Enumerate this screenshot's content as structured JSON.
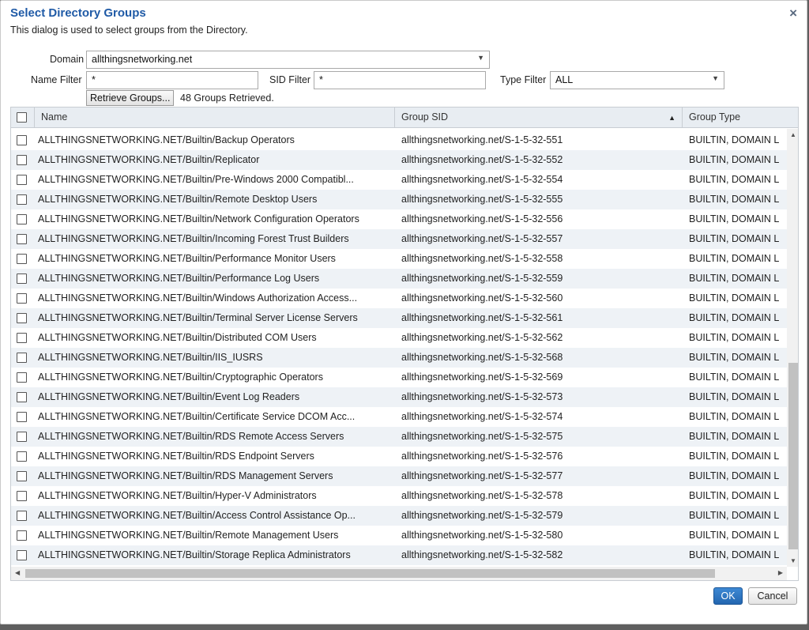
{
  "dialog": {
    "title": "Select Directory Groups",
    "subtitle": "This dialog is used to select groups from the Directory.",
    "close_icon": "×"
  },
  "filters": {
    "domain_label": "Domain",
    "domain_value": "allthingsnetworking.net",
    "name_filter_label": "Name Filter",
    "name_filter_value": "*",
    "sid_filter_label": "SID Filter",
    "sid_filter_value": "*",
    "type_filter_label": "Type Filter",
    "type_filter_value": "ALL",
    "retrieve_button": "Retrieve Groups...",
    "retrieved_status": "48 Groups Retrieved."
  },
  "table": {
    "columns": [
      "Name",
      "Group SID",
      "Group Type"
    ],
    "sort_indicator": "▲",
    "rows": [
      {
        "name": "ALLTHINGSNETWORKING.NET/Builtin/Backup Operators",
        "sid": "allthingsnetworking.net/S-1-5-32-551",
        "type": "BUILTIN, DOMAIN L"
      },
      {
        "name": "ALLTHINGSNETWORKING.NET/Builtin/Replicator",
        "sid": "allthingsnetworking.net/S-1-5-32-552",
        "type": "BUILTIN, DOMAIN L"
      },
      {
        "name": "ALLTHINGSNETWORKING.NET/Builtin/Pre-Windows 2000 Compatibl...",
        "sid": "allthingsnetworking.net/S-1-5-32-554",
        "type": "BUILTIN, DOMAIN L"
      },
      {
        "name": "ALLTHINGSNETWORKING.NET/Builtin/Remote Desktop Users",
        "sid": "allthingsnetworking.net/S-1-5-32-555",
        "type": "BUILTIN, DOMAIN L"
      },
      {
        "name": "ALLTHINGSNETWORKING.NET/Builtin/Network Configuration Operators",
        "sid": "allthingsnetworking.net/S-1-5-32-556",
        "type": "BUILTIN, DOMAIN L"
      },
      {
        "name": "ALLTHINGSNETWORKING.NET/Builtin/Incoming Forest Trust Builders",
        "sid": "allthingsnetworking.net/S-1-5-32-557",
        "type": "BUILTIN, DOMAIN L"
      },
      {
        "name": "ALLTHINGSNETWORKING.NET/Builtin/Performance Monitor Users",
        "sid": "allthingsnetworking.net/S-1-5-32-558",
        "type": "BUILTIN, DOMAIN L"
      },
      {
        "name": "ALLTHINGSNETWORKING.NET/Builtin/Performance Log Users",
        "sid": "allthingsnetworking.net/S-1-5-32-559",
        "type": "BUILTIN, DOMAIN L"
      },
      {
        "name": "ALLTHINGSNETWORKING.NET/Builtin/Windows Authorization Access...",
        "sid": "allthingsnetworking.net/S-1-5-32-560",
        "type": "BUILTIN, DOMAIN L"
      },
      {
        "name": "ALLTHINGSNETWORKING.NET/Builtin/Terminal Server License Servers",
        "sid": "allthingsnetworking.net/S-1-5-32-561",
        "type": "BUILTIN, DOMAIN L"
      },
      {
        "name": "ALLTHINGSNETWORKING.NET/Builtin/Distributed COM Users",
        "sid": "allthingsnetworking.net/S-1-5-32-562",
        "type": "BUILTIN, DOMAIN L"
      },
      {
        "name": "ALLTHINGSNETWORKING.NET/Builtin/IIS_IUSRS",
        "sid": "allthingsnetworking.net/S-1-5-32-568",
        "type": "BUILTIN, DOMAIN L"
      },
      {
        "name": "ALLTHINGSNETWORKING.NET/Builtin/Cryptographic Operators",
        "sid": "allthingsnetworking.net/S-1-5-32-569",
        "type": "BUILTIN, DOMAIN L"
      },
      {
        "name": "ALLTHINGSNETWORKING.NET/Builtin/Event Log Readers",
        "sid": "allthingsnetworking.net/S-1-5-32-573",
        "type": "BUILTIN, DOMAIN L"
      },
      {
        "name": "ALLTHINGSNETWORKING.NET/Builtin/Certificate Service DCOM Acc...",
        "sid": "allthingsnetworking.net/S-1-5-32-574",
        "type": "BUILTIN, DOMAIN L"
      },
      {
        "name": "ALLTHINGSNETWORKING.NET/Builtin/RDS Remote Access Servers",
        "sid": "allthingsnetworking.net/S-1-5-32-575",
        "type": "BUILTIN, DOMAIN L"
      },
      {
        "name": "ALLTHINGSNETWORKING.NET/Builtin/RDS Endpoint Servers",
        "sid": "allthingsnetworking.net/S-1-5-32-576",
        "type": "BUILTIN, DOMAIN L"
      },
      {
        "name": "ALLTHINGSNETWORKING.NET/Builtin/RDS Management Servers",
        "sid": "allthingsnetworking.net/S-1-5-32-577",
        "type": "BUILTIN, DOMAIN L"
      },
      {
        "name": "ALLTHINGSNETWORKING.NET/Builtin/Hyper-V Administrators",
        "sid": "allthingsnetworking.net/S-1-5-32-578",
        "type": "BUILTIN, DOMAIN L"
      },
      {
        "name": "ALLTHINGSNETWORKING.NET/Builtin/Access Control Assistance Op...",
        "sid": "allthingsnetworking.net/S-1-5-32-579",
        "type": "BUILTIN, DOMAIN L"
      },
      {
        "name": "ALLTHINGSNETWORKING.NET/Builtin/Remote Management Users",
        "sid": "allthingsnetworking.net/S-1-5-32-580",
        "type": "BUILTIN, DOMAIN L"
      },
      {
        "name": "ALLTHINGSNETWORKING.NET/Builtin/Storage Replica Administrators",
        "sid": "allthingsnetworking.net/S-1-5-32-582",
        "type": "BUILTIN, DOMAIN L"
      }
    ]
  },
  "footer": {
    "ok_label": "OK",
    "cancel_label": "Cancel"
  },
  "colors": {
    "title": "#1f5aa6",
    "ok_button": "#2b72c2",
    "header_bg": "#e8edf2",
    "alt_row_bg": "#eef2f6"
  }
}
